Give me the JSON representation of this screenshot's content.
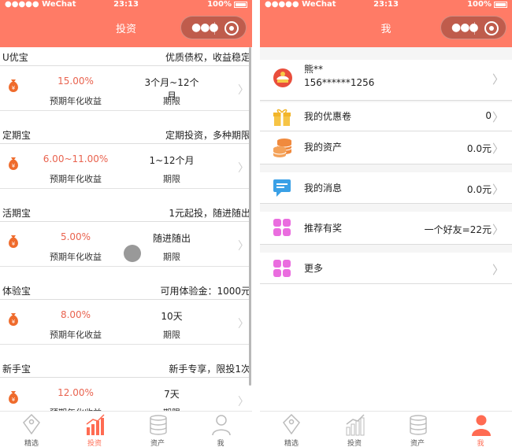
{
  "status_bar": {
    "carrier": "●●●●● WeChat",
    "time": "23:13",
    "battery": "100%"
  },
  "left": {
    "title": "投资",
    "products": [
      {
        "name": "U优宝",
        "desc": "优质债权，收益稳定",
        "rate": "15.00%",
        "rate_label": "预期年化收益",
        "period": "3个月~12个月",
        "period_label": "期限"
      },
      {
        "name": "定期宝",
        "desc": "定期投资，多种期限",
        "rate": "6.00~11.00%",
        "rate_label": "预期年化收益",
        "period": "1~12个月",
        "period_label": "期限"
      },
      {
        "name": "活期宝",
        "desc": "1元起投，随进随出",
        "rate": "5.00%",
        "rate_label": "预期年化收益",
        "period": "随进随出",
        "period_label": "期限"
      },
      {
        "name": "体验宝",
        "desc": "可用体验金：1000元",
        "rate": "8.00%",
        "rate_label": "预期年化收益",
        "period": "10天",
        "period_label": "期限"
      },
      {
        "name": "新手宝",
        "desc": "新手专享，限投1次",
        "rate": "12.00%",
        "rate_label": "预期年化收益",
        "period": "7天",
        "period_label": "期限"
      }
    ]
  },
  "right": {
    "title": "我",
    "user": {
      "name": "熊**",
      "phone": "156******1256"
    },
    "menu": [
      {
        "label": "我的优惠卷",
        "value": "0"
      },
      {
        "label": "我的资产",
        "value": "0.0元"
      },
      {
        "label": "我的消息",
        "value": "0.0元"
      },
      {
        "label": "推荐有奖",
        "value": "一个好友=22元"
      },
      {
        "label": "更多",
        "value": ""
      }
    ]
  },
  "tabs": [
    {
      "label": "精选",
      "icon": "tag-icon"
    },
    {
      "label": "投资",
      "icon": "chart-icon"
    },
    {
      "label": "资产",
      "icon": "coins-icon"
    },
    {
      "label": "我",
      "icon": "user-icon"
    }
  ],
  "colors": {
    "brand": "#ff7b66",
    "rate": "#e9634f",
    "active_tab": "#ff6b52",
    "bag": "#ef6b2c"
  }
}
